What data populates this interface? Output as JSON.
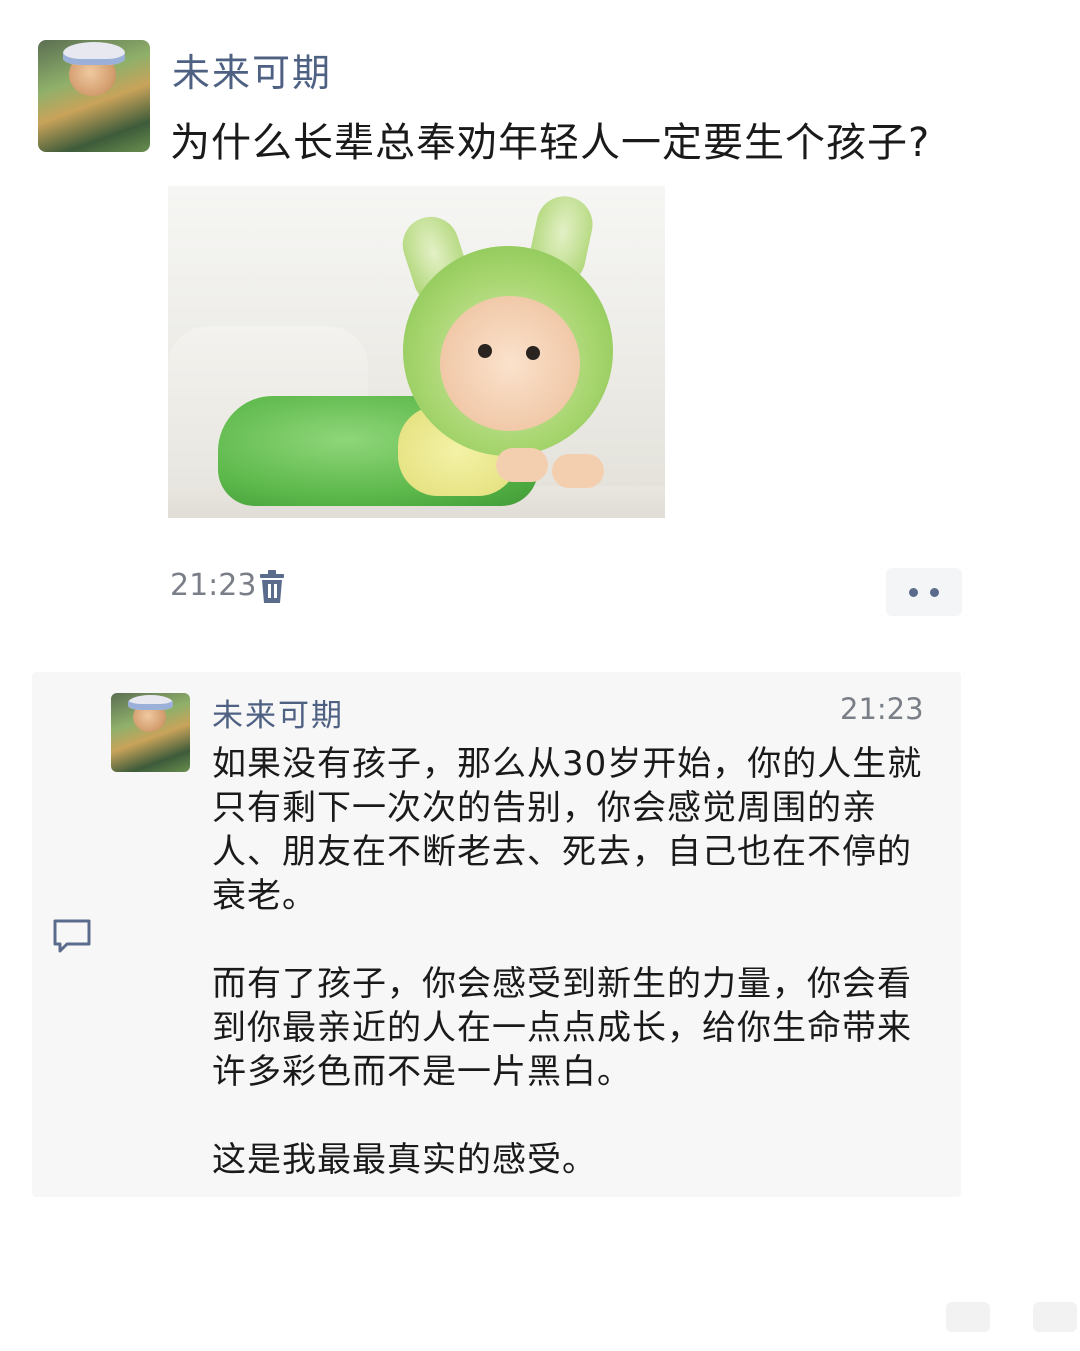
{
  "post": {
    "author": "未来可期",
    "text": "为什么长辈总奉劝年轻人一定要生个孩子?",
    "time": "21:23",
    "image_icon": "baby-photo",
    "delete_icon": "trash-icon",
    "more_icon": "more-dots-icon"
  },
  "comment": {
    "author": "未来可期",
    "time": "21:23",
    "icon": "comment-bubble-icon",
    "paragraphs": [
      "如果没有孩子，那么从30岁开始，你的人生就只有剩下一次次的告别，你会感觉周围的亲人、朋友在不断老去、死去，自己也在不停的衰老。",
      "而有了孩子，你会感受到新生的力量，你会看到你最亲近的人在一点点成长，给你生命带来许多彩色而不是一片黑白。",
      "这是我最最真实的感受。"
    ]
  },
  "colors": {
    "name": "#4f6183",
    "meta": "#7a7f87",
    "text": "#1a1a1a",
    "comment_bg": "#f7f7f7"
  }
}
